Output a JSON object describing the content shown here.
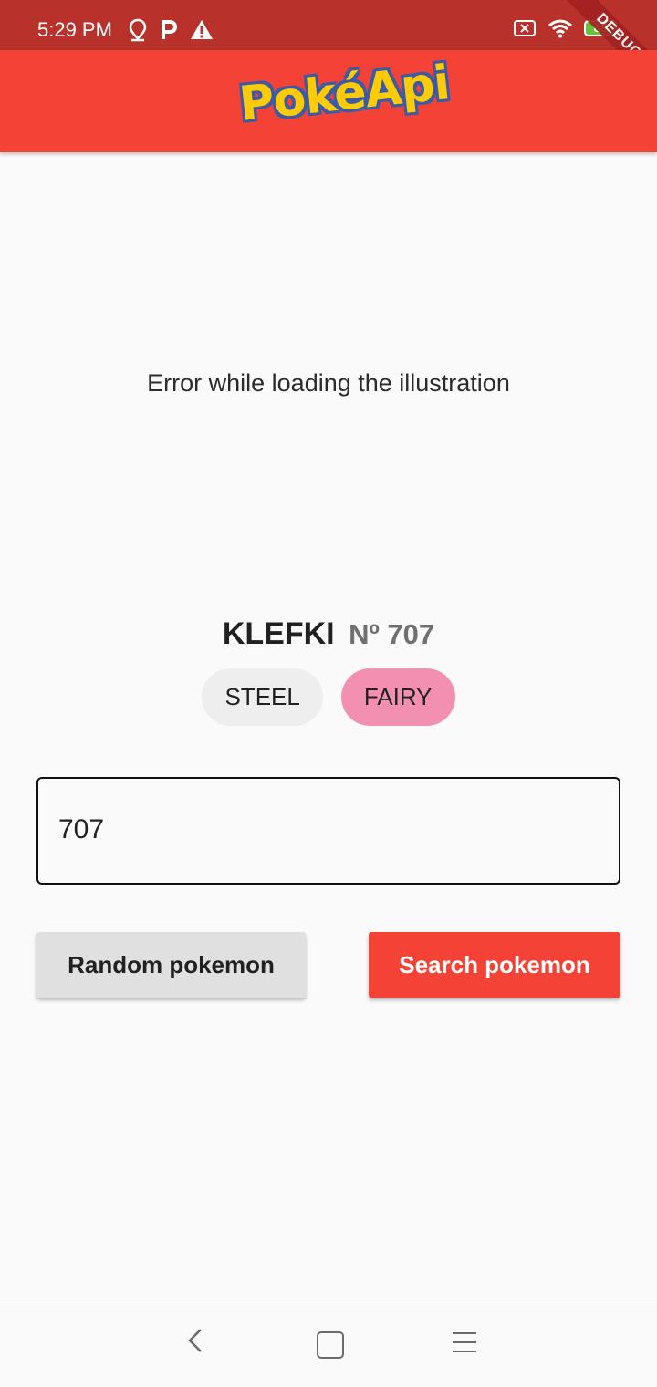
{
  "status_bar": {
    "time": "5:29 PM",
    "battery": "88",
    "left_icons": [
      "location-icon",
      "parking-icon",
      "warning-icon"
    ],
    "right_icons": [
      "sim-off-icon",
      "wifi-icon",
      "battery-icon"
    ]
  },
  "debug_banner": "DEBUG",
  "app_bar": {
    "logo_text": "PokéApi"
  },
  "illustration": {
    "error_message": "Error while loading the illustration"
  },
  "pokemon": {
    "name": "KLEFKI",
    "number": "Nº 707",
    "types": [
      "STEEL",
      "FAIRY"
    ]
  },
  "search": {
    "value": "707"
  },
  "buttons": {
    "random": "Random pokemon",
    "search": "Search pokemon"
  },
  "colors": {
    "status_bar": "#b8312b",
    "app_bar": "#f44336",
    "steel_chip": "#eeeeee",
    "fairy_chip": "#f38fb1"
  },
  "nav_bar": [
    "back-icon",
    "home-icon",
    "menu-icon"
  ]
}
